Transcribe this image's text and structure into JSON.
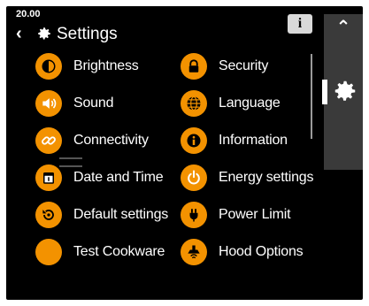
{
  "status": {
    "time": "20.00"
  },
  "header": {
    "back_icon": "chevron-left-icon",
    "gear_icon": "gear-icon",
    "title": "Settings",
    "info_label": "i"
  },
  "side": {
    "up_label": "^",
    "gear_icon": "gear-icon"
  },
  "menu": {
    "left": [
      {
        "label": "Brightness",
        "icon": "brightness-icon"
      },
      {
        "label": "Sound",
        "icon": "speaker-icon"
      },
      {
        "label": "Connectivity",
        "icon": "link-icon"
      },
      {
        "label": "Date and Time",
        "icon": "calendar-icon"
      },
      {
        "label": "Default settings",
        "icon": "reset-icon"
      },
      {
        "label": "Test Cookware",
        "icon": "cookware-icon"
      }
    ],
    "right": [
      {
        "label": "Security",
        "icon": "lock-icon"
      },
      {
        "label": "Language",
        "icon": "globe-icon"
      },
      {
        "label": "Information",
        "icon": "info-icon"
      },
      {
        "label": "Energy settings",
        "icon": "power-icon"
      },
      {
        "label": "Power Limit",
        "icon": "plug-icon"
      },
      {
        "label": "Hood Options",
        "icon": "hood-icon"
      }
    ]
  },
  "colors": {
    "accent": "#f39200",
    "background": "#000000",
    "side_panel": "#3a3a3a"
  }
}
